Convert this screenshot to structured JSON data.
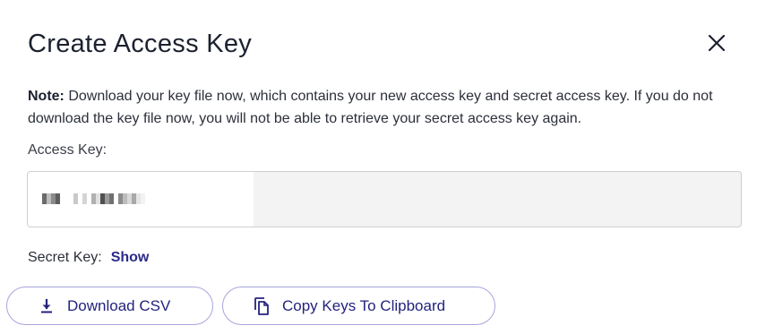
{
  "dialog": {
    "title": "Create Access Key",
    "close_icon": "close-icon"
  },
  "note": {
    "label": "Note:",
    "text": " Download your key file now, which contains your new access key and secret access key. If you do not download the key file now, you will not be able to retrieve your secret access key again."
  },
  "access_key": {
    "label": "Access Key:",
    "value_redacted": true
  },
  "secret_key": {
    "label": "Secret Key:",
    "show_label": "Show"
  },
  "buttons": {
    "download_label": "Download CSV",
    "download_icon": "download-icon",
    "copy_label": "Copy Keys To Clipboard",
    "copy_icon": "copy-icon"
  },
  "colors": {
    "accent": "#2b2a8a",
    "button_border": "#a8a5dc",
    "field_bg": "#f3f3f3"
  }
}
